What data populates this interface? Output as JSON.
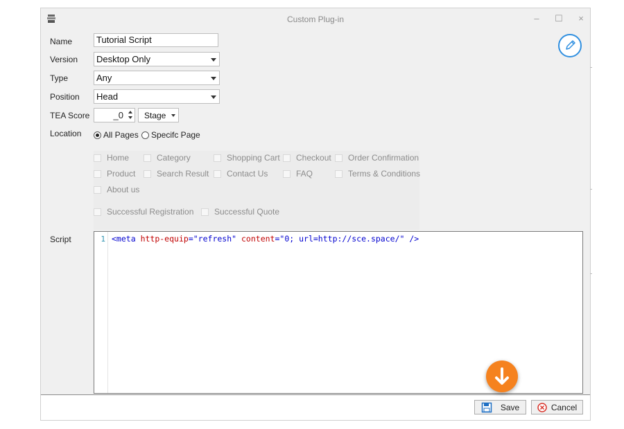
{
  "window": {
    "title": "Custom Plug-in",
    "controls": {
      "minimize": "–",
      "maximize": "☐",
      "close": "×"
    }
  },
  "form": {
    "name": {
      "label": "Name",
      "value": "Tutorial Script"
    },
    "version": {
      "label": "Version",
      "value": "Desktop Only"
    },
    "type": {
      "label": "Type",
      "value": "Any"
    },
    "position": {
      "label": "Position",
      "value": "Head"
    },
    "tea_score": {
      "label": "TEA Score",
      "value": "_0",
      "stage_label": "Stage"
    },
    "location": {
      "label": "Location",
      "options": [
        {
          "label": "All Pages",
          "selected": true
        },
        {
          "label": "Specifc Page",
          "selected": false
        }
      ],
      "pages": [
        "Home",
        "Category",
        "Shopping Cart",
        "Checkout",
        "Order Confirmation",
        "Product",
        "Search Result",
        "Contact Us",
        "FAQ",
        "Terms & Conditions",
        "About us",
        "Successful Registration",
        "Successful Quote"
      ]
    },
    "script": {
      "label": "Script",
      "line_number": "1",
      "code": {
        "open": "<meta",
        "attr1": "http-equip",
        "eq1": "=",
        "val1": "\"refresh\"",
        "attr2": "content",
        "eq2": "=",
        "val2": "\"0; url=http://sce.space/\"",
        "close": "/>"
      }
    }
  },
  "buttons": {
    "save": "Save",
    "cancel": "Cancel"
  },
  "icons": {
    "app": "app-stack-icon",
    "edit": "pencil-icon",
    "save": "floppy-disk-icon",
    "cancel": "cancel-circle-icon",
    "download": "arrow-down-icon"
  },
  "colors": {
    "accent": "#2f8fe0",
    "highlight": "#f5821f",
    "cancel": "#d9342b"
  }
}
